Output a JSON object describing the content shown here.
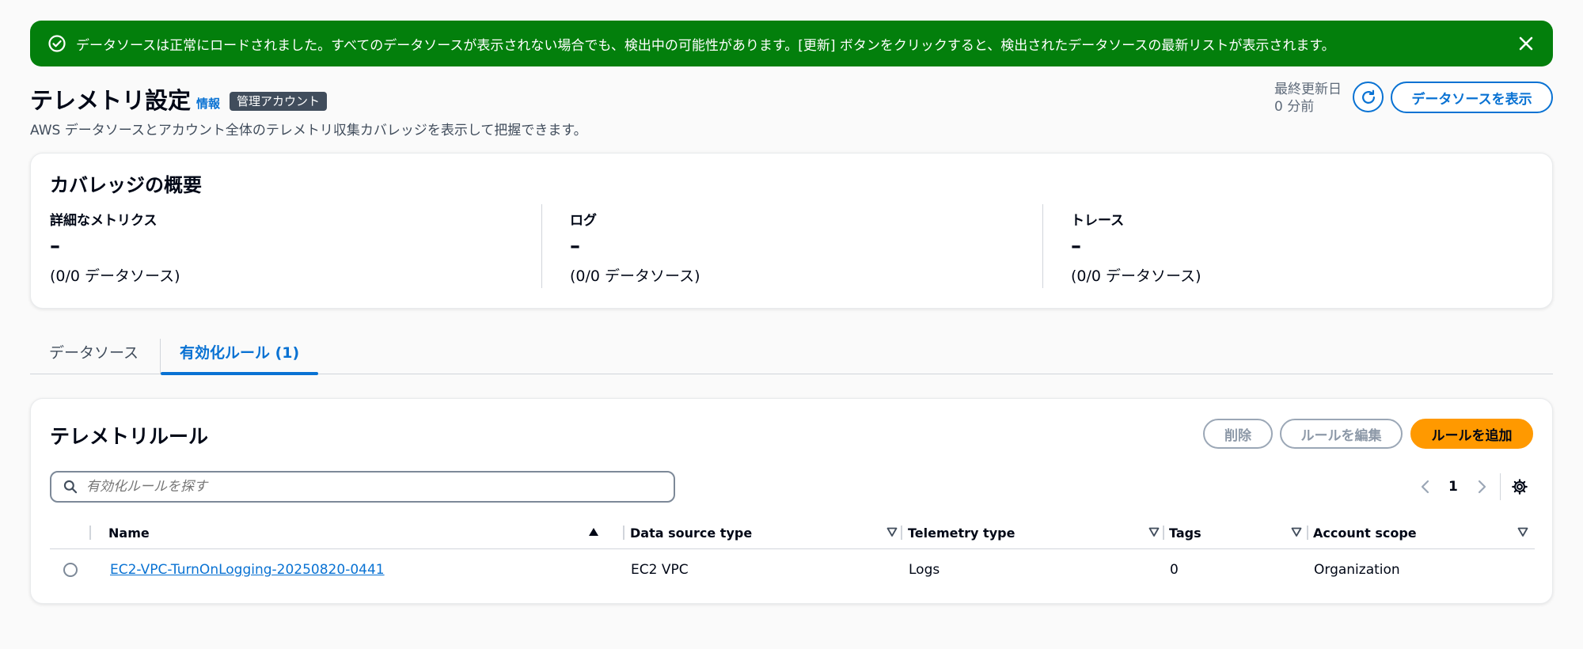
{
  "flash": {
    "message": "データソースは正常にロードされました。すべてのデータソースが表示されない場合でも、検出中の可能性があります。[更新] ボタンをクリックすると、検出されたデータソースの最新リストが表示されます。",
    "icon": "success-check-icon",
    "close_icon": "close-icon",
    "color": "#037f0c"
  },
  "header": {
    "title": "テレメトリ設定",
    "info_link": "情報",
    "badge": "管理アカウント",
    "subtitle": "AWS データソースとアカウント全体のテレメトリ収集カバレッジを表示して把握できます。",
    "last_updated_label": "最終更新日",
    "last_updated_value": "0 分前",
    "view_datasources_button": "データソースを表示"
  },
  "coverage": {
    "title": "カバレッジの概要",
    "metrics": [
      {
        "label": "詳細なメトリクス",
        "value": "–",
        "count": "(0/0 データソース)"
      },
      {
        "label": "ログ",
        "value": "–",
        "count": "(0/0 データソース)"
      },
      {
        "label": "トレース",
        "value": "–",
        "count": "(0/0 データソース)"
      }
    ]
  },
  "tabs": [
    {
      "label": "データソース",
      "selected": false
    },
    {
      "label": "有効化ルール (1)",
      "selected": true
    }
  ],
  "rules": {
    "title": "テレメトリルール",
    "delete_button": "削除",
    "edit_button": "ルールを編集",
    "add_button": "ルールを追加",
    "search_placeholder": "有効化ルールを探す",
    "page": "1",
    "columns": [
      "Name",
      "Data source type",
      "Telemetry type",
      "Tags",
      "Account scope"
    ],
    "rows": [
      {
        "name": "EC2-VPC-TurnOnLogging-20250820-0441",
        "data_source_type": "EC2 VPC",
        "telemetry_type": "Logs",
        "tags": "0",
        "account_scope": "Organization"
      }
    ]
  },
  "colors": {
    "accent": "#0972d3",
    "primary_button": "#ff9900",
    "success": "#037f0c"
  }
}
